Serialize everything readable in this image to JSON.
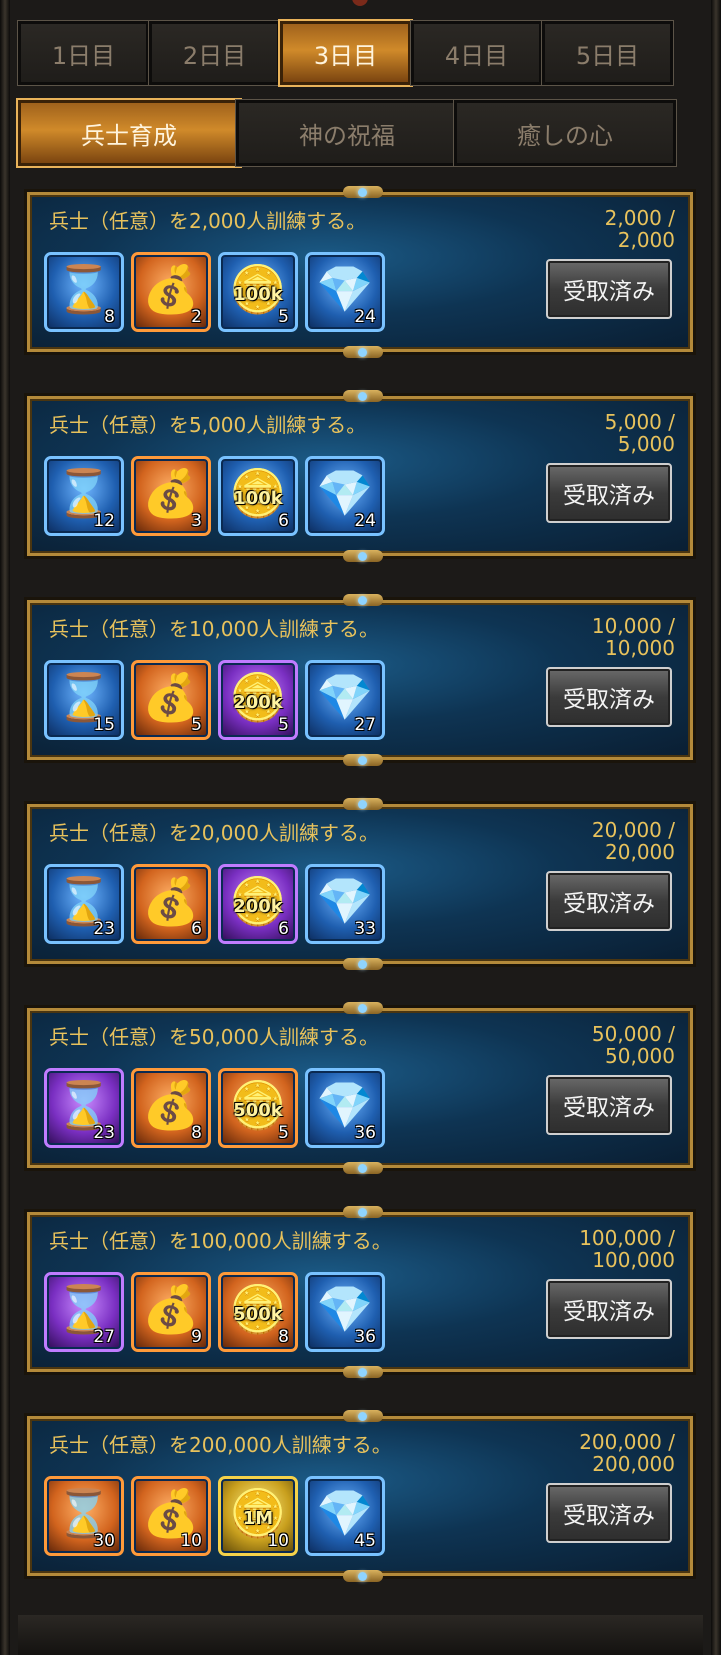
{
  "day_tabs": [
    "1日目",
    "2日目",
    "3日目",
    "4日目",
    "5日目"
  ],
  "active_day_index": 2,
  "category_tabs": [
    "兵士育成",
    "神の祝福",
    "癒しの心"
  ],
  "active_category_index": 0,
  "tasks": [
    {
      "title": "兵士（任意）を2,000人訓練する。",
      "progress": "2,000 / 2,000",
      "button": "受取済み",
      "rewards": [
        {
          "icon": "hourglass-speedup-icon",
          "rarity": "blue",
          "label": "",
          "qty": "8"
        },
        {
          "icon": "resource-bag-icon",
          "rarity": "orange",
          "label": "",
          "qty": "2"
        },
        {
          "icon": "gold-chest-icon",
          "rarity": "blue",
          "label": "100k",
          "qty": "5"
        },
        {
          "icon": "crystal-icon",
          "rarity": "blue",
          "label": "",
          "qty": "24"
        }
      ]
    },
    {
      "title": "兵士（任意）を5,000人訓練する。",
      "progress": "5,000 / 5,000",
      "button": "受取済み",
      "rewards": [
        {
          "icon": "hourglass-speedup-icon",
          "rarity": "blue",
          "label": "",
          "qty": "12"
        },
        {
          "icon": "resource-bag-icon",
          "rarity": "orange",
          "label": "",
          "qty": "3"
        },
        {
          "icon": "gold-chest-icon",
          "rarity": "blue",
          "label": "100k",
          "qty": "6"
        },
        {
          "icon": "crystal-icon",
          "rarity": "blue",
          "label": "",
          "qty": "24"
        }
      ]
    },
    {
      "title": "兵士（任意）を10,000人訓練する。",
      "progress": "10,000 / 10,000",
      "button": "受取済み",
      "rewards": [
        {
          "icon": "hourglass-speedup-icon",
          "rarity": "blue",
          "label": "",
          "qty": "15"
        },
        {
          "icon": "resource-bag-icon",
          "rarity": "orange",
          "label": "",
          "qty": "5"
        },
        {
          "icon": "gold-chest-icon",
          "rarity": "purple",
          "label": "200k",
          "qty": "5"
        },
        {
          "icon": "crystal-icon",
          "rarity": "blue",
          "label": "",
          "qty": "27"
        }
      ]
    },
    {
      "title": "兵士（任意）を20,000人訓練する。",
      "progress": "20,000 / 20,000",
      "button": "受取済み",
      "rewards": [
        {
          "icon": "hourglass-speedup-icon",
          "rarity": "blue",
          "label": "",
          "qty": "23"
        },
        {
          "icon": "resource-bag-icon",
          "rarity": "orange",
          "label": "",
          "qty": "6"
        },
        {
          "icon": "gold-chest-icon",
          "rarity": "purple",
          "label": "200k",
          "qty": "6"
        },
        {
          "icon": "crystal-icon",
          "rarity": "blue",
          "label": "",
          "qty": "33"
        }
      ]
    },
    {
      "title": "兵士（任意）を50,000人訓練する。",
      "progress": "50,000 / 50,000",
      "button": "受取済み",
      "rewards": [
        {
          "icon": "hourglass-speedup-icon",
          "rarity": "purple",
          "label": "",
          "qty": "23"
        },
        {
          "icon": "resource-bag-icon",
          "rarity": "orange",
          "label": "",
          "qty": "8"
        },
        {
          "icon": "gold-chest-icon",
          "rarity": "orange",
          "label": "500k",
          "qty": "5"
        },
        {
          "icon": "crystal-icon",
          "rarity": "blue",
          "label": "",
          "qty": "36"
        }
      ]
    },
    {
      "title": "兵士（任意）を100,000人訓練する。",
      "progress": "100,000 / 100,000",
      "button": "受取済み",
      "rewards": [
        {
          "icon": "hourglass-speedup-icon",
          "rarity": "purple",
          "label": "",
          "qty": "27"
        },
        {
          "icon": "resource-bag-icon",
          "rarity": "orange",
          "label": "",
          "qty": "9"
        },
        {
          "icon": "gold-chest-icon",
          "rarity": "orange",
          "label": "500k",
          "qty": "8"
        },
        {
          "icon": "crystal-icon",
          "rarity": "blue",
          "label": "",
          "qty": "36"
        }
      ]
    },
    {
      "title": "兵士（任意）を200,000人訓練する。",
      "progress": "200,000 / 200,000",
      "button": "受取済み",
      "rewards": [
        {
          "icon": "hourglass-speedup-icon",
          "rarity": "orange",
          "label": "",
          "qty": "30"
        },
        {
          "icon": "resource-bag-icon",
          "rarity": "orange",
          "label": "",
          "qty": "10"
        },
        {
          "icon": "gold-chest-icon",
          "rarity": "gold",
          "label": "1M",
          "qty": "10"
        },
        {
          "icon": "crystal-icon",
          "rarity": "blue",
          "label": "",
          "qty": "45"
        }
      ]
    }
  ]
}
